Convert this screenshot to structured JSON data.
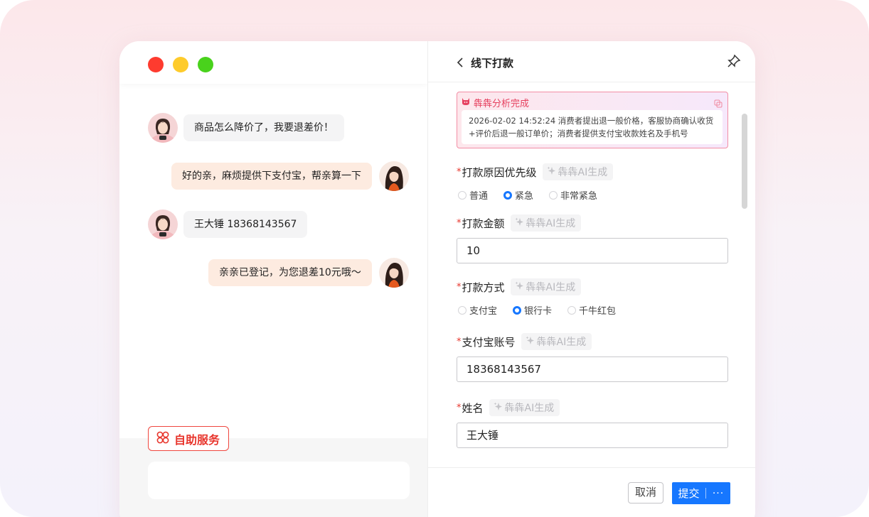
{
  "window": {
    "traffic_lights": [
      "close",
      "minimize",
      "maximize"
    ]
  },
  "chat": {
    "messages": [
      {
        "from": "customer",
        "text": "商品怎么降价了，我要退差价！"
      },
      {
        "from": "agent",
        "text": "好的亲，麻烦提供下支付宝，帮亲算一下"
      },
      {
        "from": "customer",
        "text": "王大锤 18368143567"
      },
      {
        "from": "agent",
        "text": "亲亲已登记，为您退差10元哦～"
      }
    ],
    "self_service_label": "自助服务",
    "input_placeholder": ""
  },
  "panel": {
    "title": "线下打款",
    "ai_card": {
      "title": "犇犇分析完成",
      "body": "2026-02-02 14:52:24 消费者提出退一般价格，客服协商确认收货+评价后退一般订单价；消费者提供支付宝收款姓名及手机号"
    },
    "ai_generate_label": "犇犇AI生成",
    "required_mark": "*",
    "fields": {
      "priority": {
        "label": "打款原因优先级",
        "options": [
          "普通",
          "紧急",
          "非常紧急"
        ],
        "selected": "紧急"
      },
      "amount": {
        "label": "打款金额",
        "value": "10"
      },
      "method": {
        "label": "打款方式",
        "options": [
          "支付宝",
          "银行卡",
          "千牛红包"
        ],
        "selected": "银行卡"
      },
      "alipay_account": {
        "label": "支付宝账号",
        "value": "18368143567"
      },
      "name": {
        "label": "姓名",
        "value": "王大锤"
      }
    },
    "footer": {
      "cancel_label": "取消",
      "submit_label": "提交",
      "more_label": "···"
    }
  },
  "colors": {
    "accent": "#1677ff",
    "brand_red": "#e8362d",
    "ai_pink": "#e6405f"
  }
}
